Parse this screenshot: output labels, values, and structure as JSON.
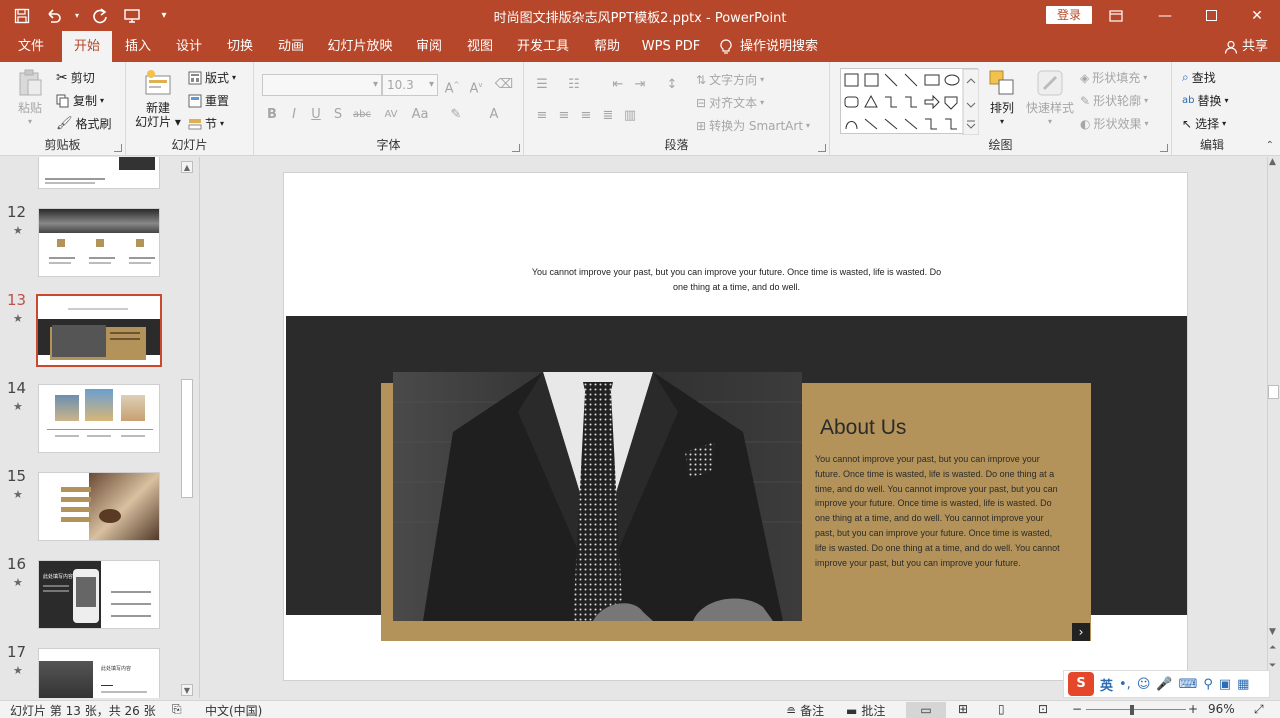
{
  "window": {
    "doc_title": "时尚图文排版杂志风PPT模板2.pptx  -  PowerPoint",
    "login_label": "登录",
    "colors": {
      "accent": "#b7472a",
      "gold": "#b39359",
      "dark": "#2b2b2b"
    }
  },
  "tabs": [
    {
      "label": "文件"
    },
    {
      "label": "开始"
    },
    {
      "label": "插入"
    },
    {
      "label": "设计"
    },
    {
      "label": "切换"
    },
    {
      "label": "动画"
    },
    {
      "label": "幻灯片放映"
    },
    {
      "label": "审阅"
    },
    {
      "label": "视图"
    },
    {
      "label": "开发工具"
    },
    {
      "label": "帮助"
    },
    {
      "label": "WPS PDF"
    },
    {
      "label": "操作说明搜索"
    }
  ],
  "share_label": "共享",
  "ribbon": {
    "clipboard": {
      "label": "剪贴板",
      "paste": "粘贴",
      "cut": "剪切",
      "copy": "复制",
      "format_painter": "格式刷"
    },
    "slides": {
      "label": "幻灯片",
      "new_slide": "新建",
      "new_slide2": "幻灯片",
      "layout": "版式",
      "reset": "重置",
      "section": "节"
    },
    "font": {
      "label": "字体",
      "font_size": "10.3",
      "bold": "B",
      "italic": "I",
      "underline": "U",
      "shadow": "S",
      "strike": "abc",
      "spacing": "AV",
      "case": "Aa",
      "color": "A"
    },
    "paragraph": {
      "label": "段落",
      "text_direction": "文字方向",
      "align_text": "对齐文本",
      "smartart": "转换为 SmartArt"
    },
    "drawing": {
      "label": "绘图",
      "arrange": "排列",
      "quick_styles": "快速样式",
      "shape_fill": "形状填充",
      "shape_outline": "形状轮廓",
      "shape_effects": "形状效果"
    },
    "editing": {
      "label": "编辑",
      "find": "查找",
      "replace": "替换",
      "select": "选择"
    }
  },
  "thumbnails": [
    {
      "num": "12",
      "star": "★"
    },
    {
      "num": "13",
      "star": "★"
    },
    {
      "num": "14",
      "star": "★"
    },
    {
      "num": "15",
      "star": "★"
    },
    {
      "num": "16",
      "star": "★",
      "text": "此处填写内容"
    },
    {
      "num": "17",
      "star": "★",
      "text": "此处填写内容"
    }
  ],
  "slide": {
    "quote": "You cannot improve your past, but you can improve your future. Once time is wasted, life is wasted. Do one thing at a time, and do well.",
    "about_title": "About Us",
    "about_body": "You cannot improve your past, but you can improve your future. Once time is wasted, life is wasted. Do one thing at a time, and do well. You cannot improve your past, but you can improve your future. Once time is wasted, life is wasted. Do one thing at a time, and do well. You cannot improve your past, but you can improve your future. Once time is wasted, life is wasted. Do one thing at a time, and do well. You cannot improve your past, but you can improve your future."
  },
  "status": {
    "slide_info": "幻灯片 第 13 张，共 26 张",
    "language": "中文(中国)",
    "notes": "备注",
    "comments": "批注",
    "zoom": "96%"
  },
  "ime": {
    "lang": "英"
  }
}
